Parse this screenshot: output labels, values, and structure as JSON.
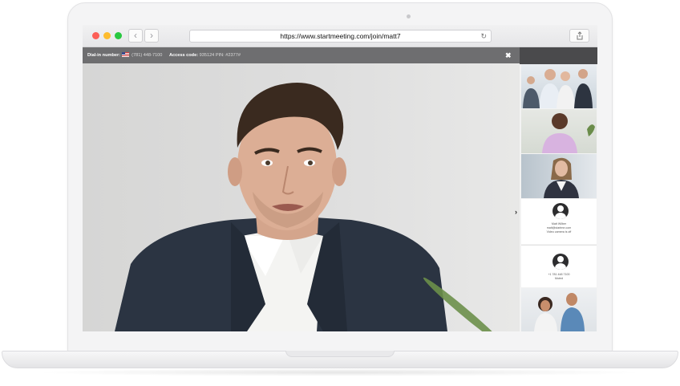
{
  "browser": {
    "url": "https://www.startmeeting.com/join/matt7",
    "back_glyph": "‹",
    "forward_glyph": "›",
    "reload_glyph": "↻"
  },
  "meeting": {
    "dialin_label": "Dial-in number:",
    "dialin_value": "(781) 448-7100",
    "access_label": "Access code:",
    "access_value": "935124 PIN: #2377#",
    "close_glyph": "✖",
    "collapse_glyph": "›"
  },
  "participants": [
    {
      "name": "Matt Wilber",
      "email": "matt@startme.com",
      "status": "Video camera is off"
    },
    {
      "name": "+1 781 448 7100",
      "status": "Muted"
    }
  ],
  "icons": {
    "share": "share-icon",
    "close": "close-icon",
    "avatar": "user-avatar-icon",
    "chevron": "chevron-right-icon"
  }
}
